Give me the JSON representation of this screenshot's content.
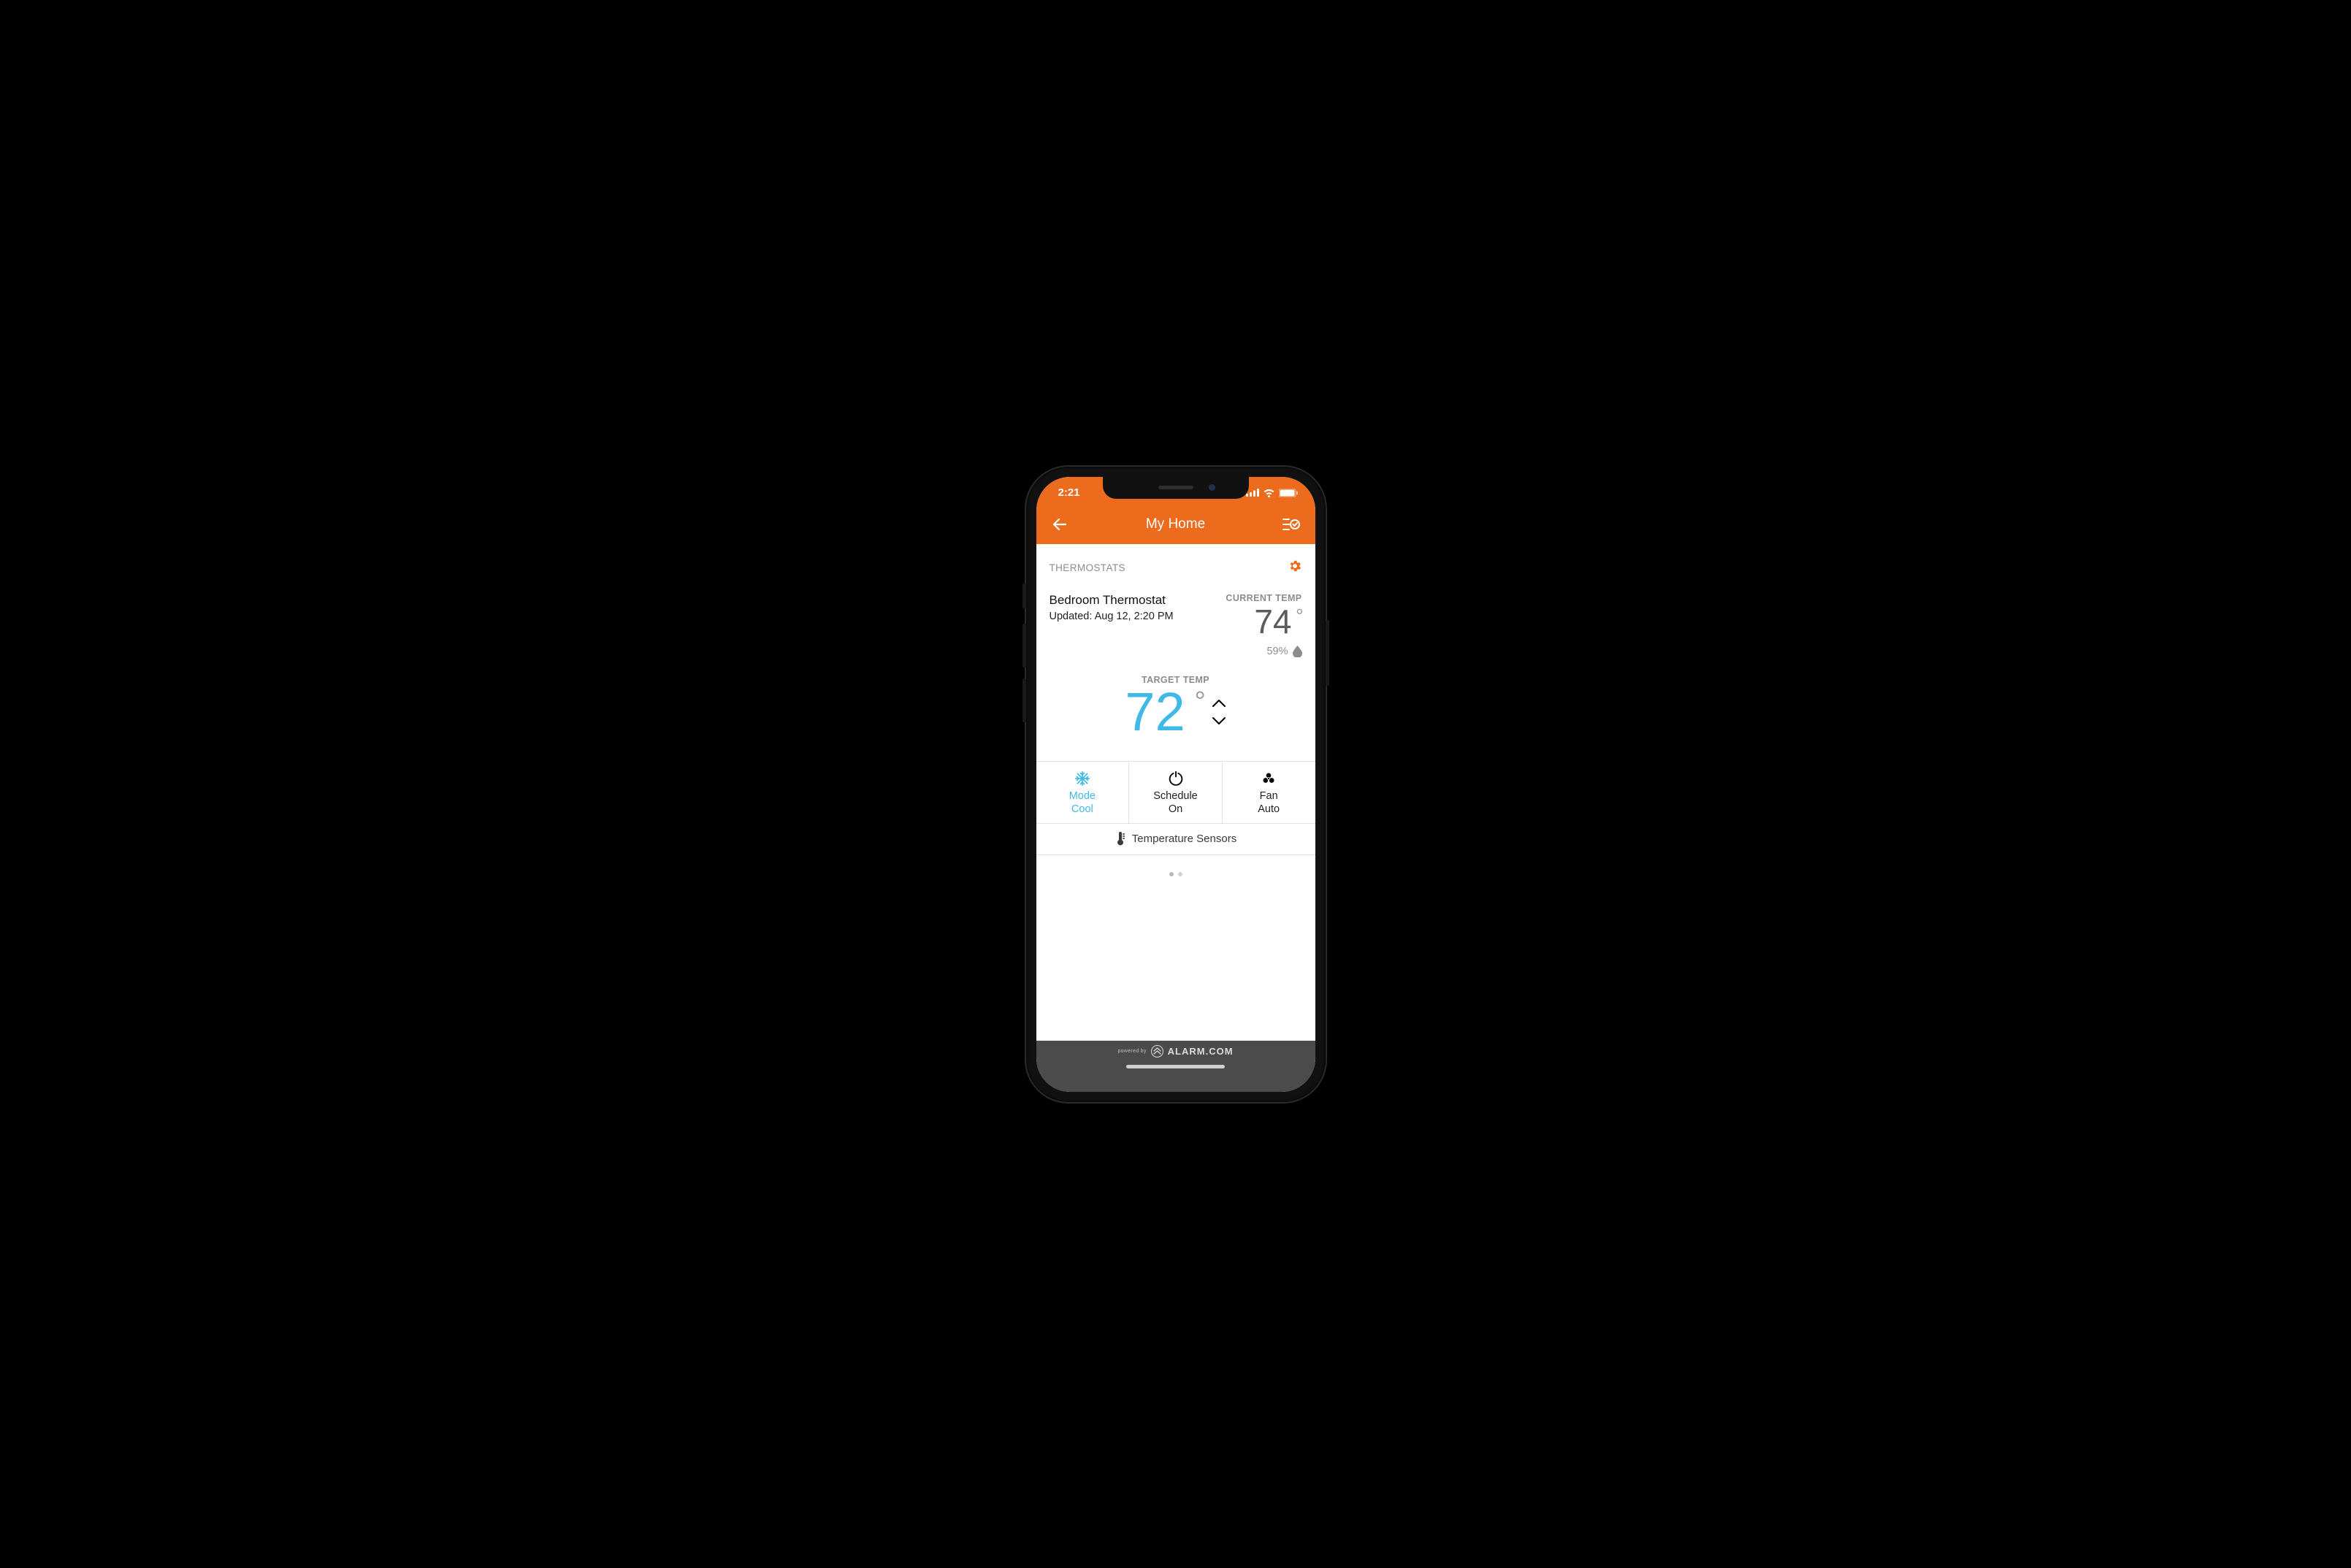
{
  "status": {
    "time": "2:21"
  },
  "nav": {
    "title": "My Home"
  },
  "section": {
    "label": "THERMOSTATS"
  },
  "device": {
    "name": "Bedroom Thermostat",
    "updated": "Updated: Aug 12, 2:20 PM"
  },
  "current": {
    "label": "CURRENT TEMP",
    "temp": "74",
    "humidity": "59%"
  },
  "target": {
    "label": "TARGET TEMP",
    "temp": "72"
  },
  "controls": {
    "mode": {
      "line1": "Mode",
      "line2": "Cool"
    },
    "schedule": {
      "line1": "Schedule",
      "line2": "On"
    },
    "fan": {
      "line1": "Fan",
      "line2": "Auto"
    }
  },
  "sensors": {
    "label": "Temperature Sensors"
  },
  "footer": {
    "powered": "powered by",
    "brand": "ALARM.COM"
  }
}
